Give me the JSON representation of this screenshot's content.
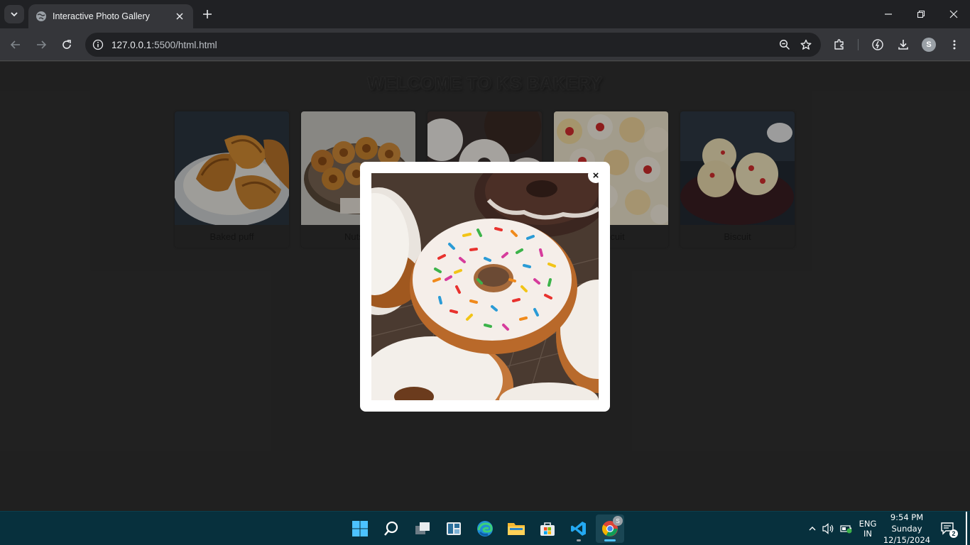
{
  "browser": {
    "tab_title": "Interactive Photo Gallery",
    "url_host": "127.0.0.1",
    "url_rest": ":5500/html.html",
    "profile_initial": "S"
  },
  "page": {
    "title": "WELCOME TO KS BAKERY",
    "gallery": [
      {
        "caption": "Baked puff",
        "image": "croissant-photo"
      },
      {
        "caption": "Nuts B",
        "image": "nut-cookies-photo"
      },
      {
        "caption": "",
        "image": "donuts-photo"
      },
      {
        "caption": "Biscuit",
        "image": "sprinkle-cookies-photo"
      },
      {
        "caption": "Biscuit",
        "image": "cherry-cookies-photo"
      }
    ]
  },
  "modal": {
    "close_label": "×",
    "image": "sprinkle-donut-photo"
  },
  "taskbar": {
    "language": "ENG",
    "region": "IN",
    "time": "9:54 PM",
    "day": "Sunday",
    "date": "12/15/2024",
    "notification_count": "2",
    "chrome_badge": "S"
  },
  "colors": {
    "page_background": "#303030",
    "tabstrip": "#202124",
    "toolbar": "#35363a",
    "taskbar": "#07303d",
    "modal": "#ffffff"
  }
}
